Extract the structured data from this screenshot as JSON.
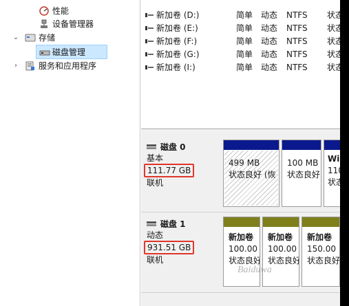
{
  "tree": {
    "performance_label": "性能",
    "device_manager_label": "设备管理器",
    "storage_label": "存储",
    "disk_mgmt_label": "磁盘管理",
    "services_label": "服务和应用程序"
  },
  "volumes": [
    {
      "name": "新加卷 (D:)",
      "layout": "简单",
      "type": "动态",
      "fs": "NTFS",
      "status": "状态"
    },
    {
      "name": "新加卷 (E:)",
      "layout": "简单",
      "type": "动态",
      "fs": "NTFS",
      "status": "状态"
    },
    {
      "name": "新加卷 (F:)",
      "layout": "简单",
      "type": "动态",
      "fs": "NTFS",
      "status": "状态"
    },
    {
      "name": "新加卷 (G:)",
      "layout": "简单",
      "type": "动态",
      "fs": "NTFS",
      "status": "状态"
    },
    {
      "name": "新加卷 (I:)",
      "layout": "简单",
      "type": "动态",
      "fs": "NTFS",
      "status": "状态"
    }
  ],
  "disks": [
    {
      "name": "磁盘 0",
      "kind": "基本",
      "size": "111.77 GB",
      "state": "联机",
      "partitions": [
        {
          "title": "",
          "size": "499 MB",
          "status": "状态良好 (恢"
        },
        {
          "title": "",
          "size": "100 MB",
          "status": "状态良好"
        },
        {
          "title": "Wi",
          "size": "110",
          "status": "状态"
        }
      ]
    },
    {
      "name": "磁盘 1",
      "kind": "动态",
      "size": "931.51 GB",
      "state": "联机",
      "partitions": [
        {
          "title": "新加卷",
          "size": "100.00",
          "status": "状态良好"
        },
        {
          "title": "新加卷",
          "size": "100.00",
          "status": "状态良好"
        },
        {
          "title": "新加卷",
          "size": "150.00",
          "status": "状态良好"
        }
      ]
    }
  ],
  "colors": {
    "basic_bar": "#0a1a8c",
    "dynamic_bar": "#7f7f1c",
    "highlight": "#e0352b",
    "selection": "#cce8ff"
  },
  "watermark": "Baiduwa"
}
